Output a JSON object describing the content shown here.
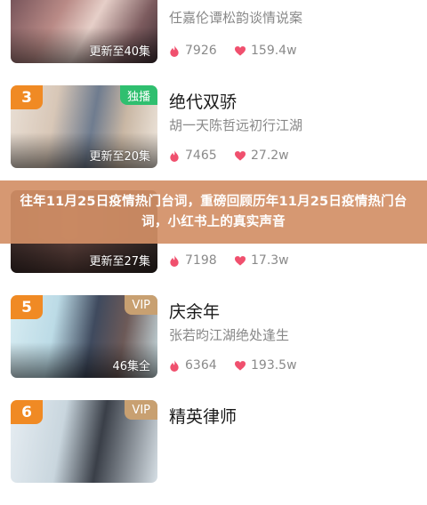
{
  "banner": {
    "text": "往年11月25日疫情热门台词，重磅回顾历年11月25日疫情热门台词，小红书上的真实声音"
  },
  "colors": {
    "rank_badge": "#f08a24",
    "exclusive_badge": "#2fbf6f",
    "vip_badge": "#c8a071",
    "stat_icon": "#f0506e",
    "banner_overlay": "#d28f66"
  },
  "items": [
    {
      "rank": "",
      "badge": "",
      "episodes": "更新至40集",
      "title": "",
      "subtitle": "任嘉伦谭松韵谈情说案",
      "heat": "7926",
      "likes": "159.4w"
    },
    {
      "rank": "3",
      "badge": "独播",
      "episodes": "更新至20集",
      "title": "绝代双骄",
      "subtitle": "胡一天陈哲远初行江湖",
      "heat": "7465",
      "likes": "27.2w"
    },
    {
      "rank": "",
      "badge": "",
      "episodes": "更新至27集",
      "title": "",
      "subtitle": "",
      "heat": "7198",
      "likes": "17.3w"
    },
    {
      "rank": "5",
      "badge": "VIP",
      "episodes": "46集全",
      "title": "庆余年",
      "subtitle": "张若昀江湖绝处逢生",
      "heat": "6364",
      "likes": "193.5w"
    },
    {
      "rank": "6",
      "badge": "VIP",
      "episodes": "",
      "title": "精英律师",
      "subtitle": "",
      "heat": "",
      "likes": ""
    }
  ],
  "icons": {
    "heat": "fire-icon",
    "likes": "heart-icon"
  }
}
